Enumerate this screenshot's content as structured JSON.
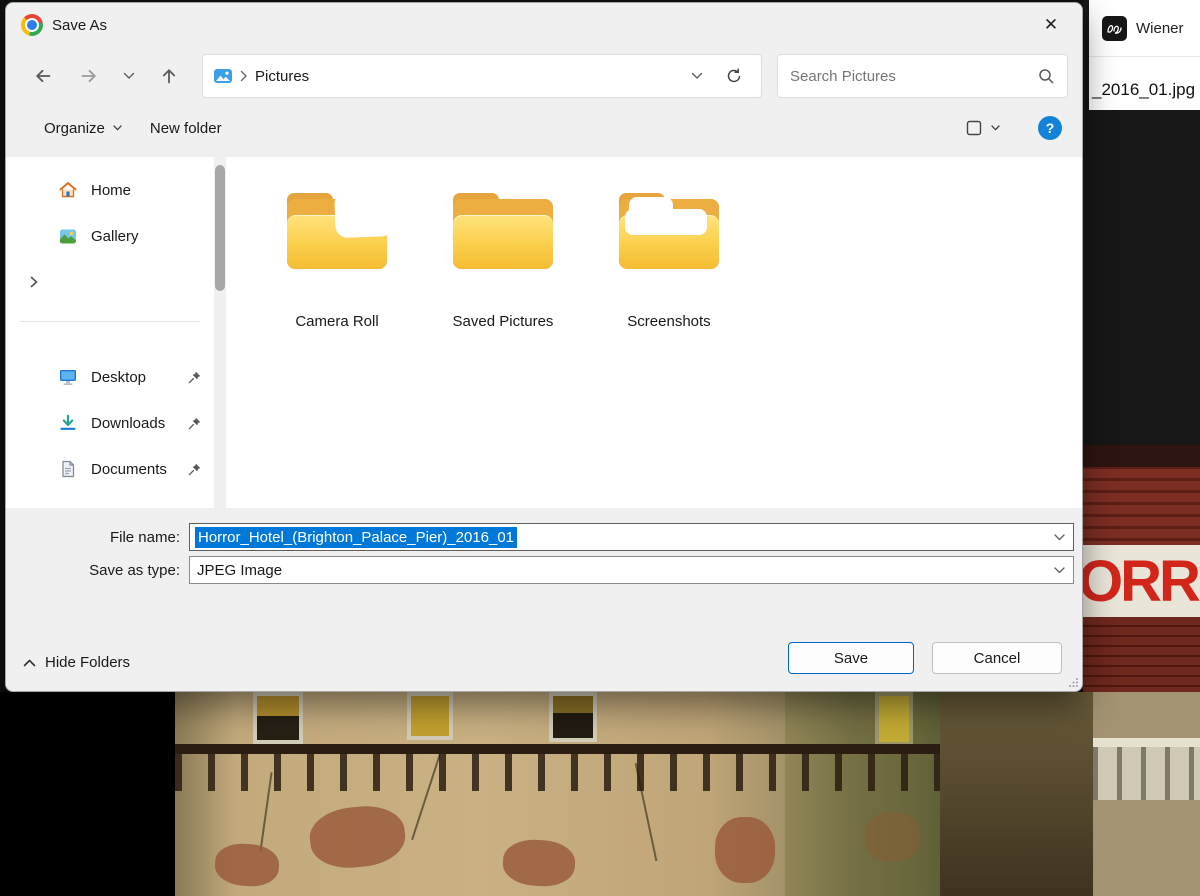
{
  "dialog": {
    "title": "Save As",
    "close_glyph": "✕"
  },
  "nav": {
    "breadcrumb": "Pictures",
    "search_placeholder": "Search Pictures"
  },
  "toolbar": {
    "organize": "Organize",
    "new_folder": "New folder",
    "help_glyph": "?"
  },
  "sidebar": {
    "items": [
      {
        "label": "Home"
      },
      {
        "label": "Gallery"
      },
      {
        "label": "Desktop",
        "pinned": true
      },
      {
        "label": "Downloads",
        "pinned": true
      },
      {
        "label": "Documents",
        "pinned": true
      }
    ]
  },
  "files": {
    "folders": [
      {
        "name": "Camera Roll"
      },
      {
        "name": "Saved Pictures"
      },
      {
        "name": "Screenshots"
      }
    ]
  },
  "fields": {
    "file_name_label": "File name:",
    "file_name_value": "Horror_Hotel_(Brighton_Palace_Pier)_2016_01",
    "save_as_type_label": "Save as type:",
    "save_as_type_value": "JPEG Image"
  },
  "footer": {
    "hide_folders": "Hide Folders",
    "save": "Save",
    "cancel": "Cancel"
  },
  "background": {
    "tab_title": "Wiener",
    "page_filename": "_2016_01.jpg",
    "sign_text": "ORR"
  },
  "colors": {
    "accent": "#0078d4",
    "selection_blue": "#0078d7",
    "help_blue": "#1283d8",
    "sign_red": "#d2261b",
    "folder_yellow": "#fbcf4b"
  }
}
